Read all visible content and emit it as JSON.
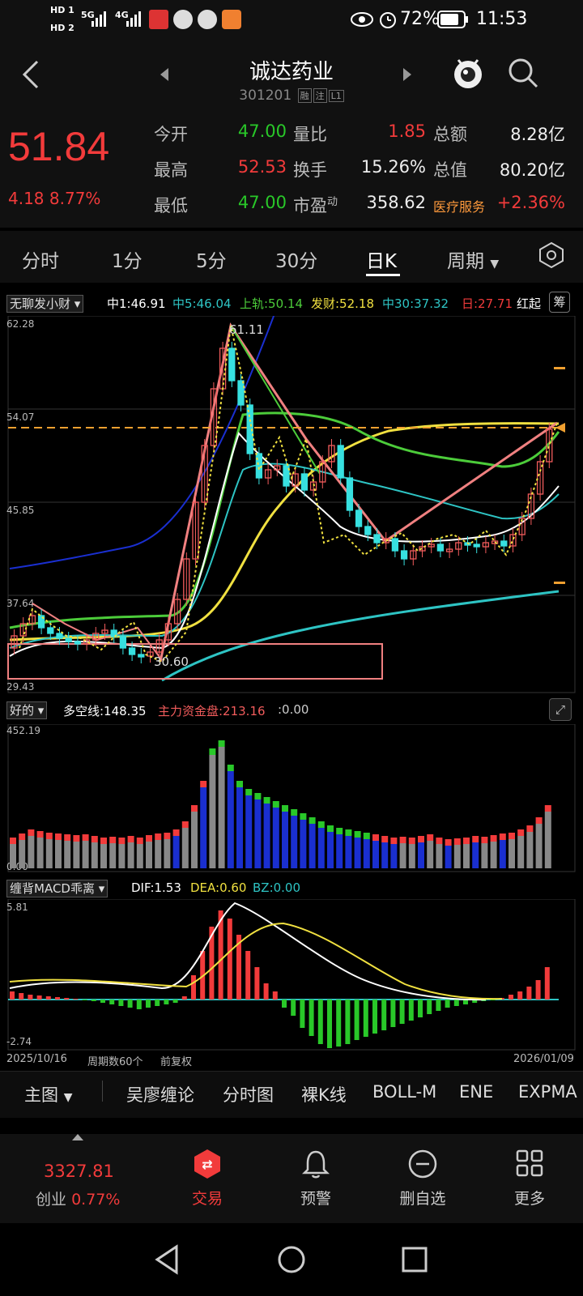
{
  "status_bar": {
    "hd1": "HD 1",
    "hd2": "HD 2",
    "net1": "5G",
    "net2": "4G",
    "battery": "72%",
    "time": "11:53"
  },
  "header": {
    "title": "诚达药业",
    "code": "301201",
    "tag1": "融",
    "tag2": "注",
    "tag3": "L1"
  },
  "quote": {
    "price": "51.84",
    "change": "4.18 8.77%",
    "rows": [
      {
        "l1": "今开",
        "v1": "47.00",
        "l2": "量比",
        "v2": "1.85",
        "l3": "总额",
        "v3": "8.28亿"
      },
      {
        "l1": "最高",
        "v1": "52.53",
        "l2": "换手",
        "v2": "15.26%",
        "l3": "总值",
        "v3": "80.20亿"
      },
      {
        "l1": "最低",
        "v1": "47.00",
        "l2": "市盈",
        "v2sup": "动",
        "v2": "358.62",
        "l3": "医疗服务",
        "v3": "+2.36%"
      }
    ]
  },
  "tabs": [
    "分时",
    "1分",
    "5分",
    "30分",
    "日K",
    "周期"
  ],
  "indicator_bar": {
    "dropdown": "无聊发小财",
    "items": [
      {
        "text": "中1:46.91",
        "color": "#ffffff"
      },
      {
        "text": "中5:46.04",
        "color": "#2ec4c4"
      },
      {
        "text": "上轨:50.14",
        "color": "#4ccc3a"
      },
      {
        "text": "发财:52.18",
        "color": "#f0e040"
      },
      {
        "text": "中30:37.32",
        "color": "#2ec4c4"
      },
      {
        "text": "日:27.71",
        "color": "#f23b3b"
      },
      {
        "text": "红起",
        "color": "#ffffff"
      }
    ],
    "chip": "筹"
  },
  "main_chart": {
    "y_labels": [
      "62.28",
      "54.07",
      "45.85",
      "37.64",
      "29.43"
    ],
    "high_label": "61.11",
    "low_label": "30.60",
    "colors": {
      "up": "#f25c5c",
      "down": "#37e0e0",
      "ma_white": "#ffffff",
      "ma_cyan": "#2ec4c4",
      "ma_green": "#4ccc3a",
      "ma_yellow": "#f0e040",
      "ma_blue": "#1a2fd0",
      "dashed": "#f0a030"
    }
  },
  "sub_chart1": {
    "dropdown": "好的",
    "label1": "多空线:148.35",
    "label2": "主力资金盘:213.16",
    "label3": ":0.00",
    "ymax": "452.19",
    "ymin": "0.00"
  },
  "sub_chart2": {
    "dropdown": "缠背MACD乖离",
    "dif": "DIF:1.53",
    "dea": "DEA:0.60",
    "bz": "BZ:0.00",
    "ymax": "5.81",
    "ymin": "-2.74"
  },
  "date_axis": {
    "start": "2025/10/16",
    "period": "周期数60个",
    "adjust": "前复权",
    "end": "2026/01/09"
  },
  "bottom_menu": [
    "主图",
    "吴廖缠论",
    "分时图",
    "裸K线",
    "BOLL-M",
    "ENE",
    "EXPMA"
  ],
  "nav": {
    "index_value": "3327.81",
    "index_name": "创业",
    "index_change": "0.77%",
    "items": [
      "交易",
      "预警",
      "删自选",
      "更多"
    ]
  }
}
